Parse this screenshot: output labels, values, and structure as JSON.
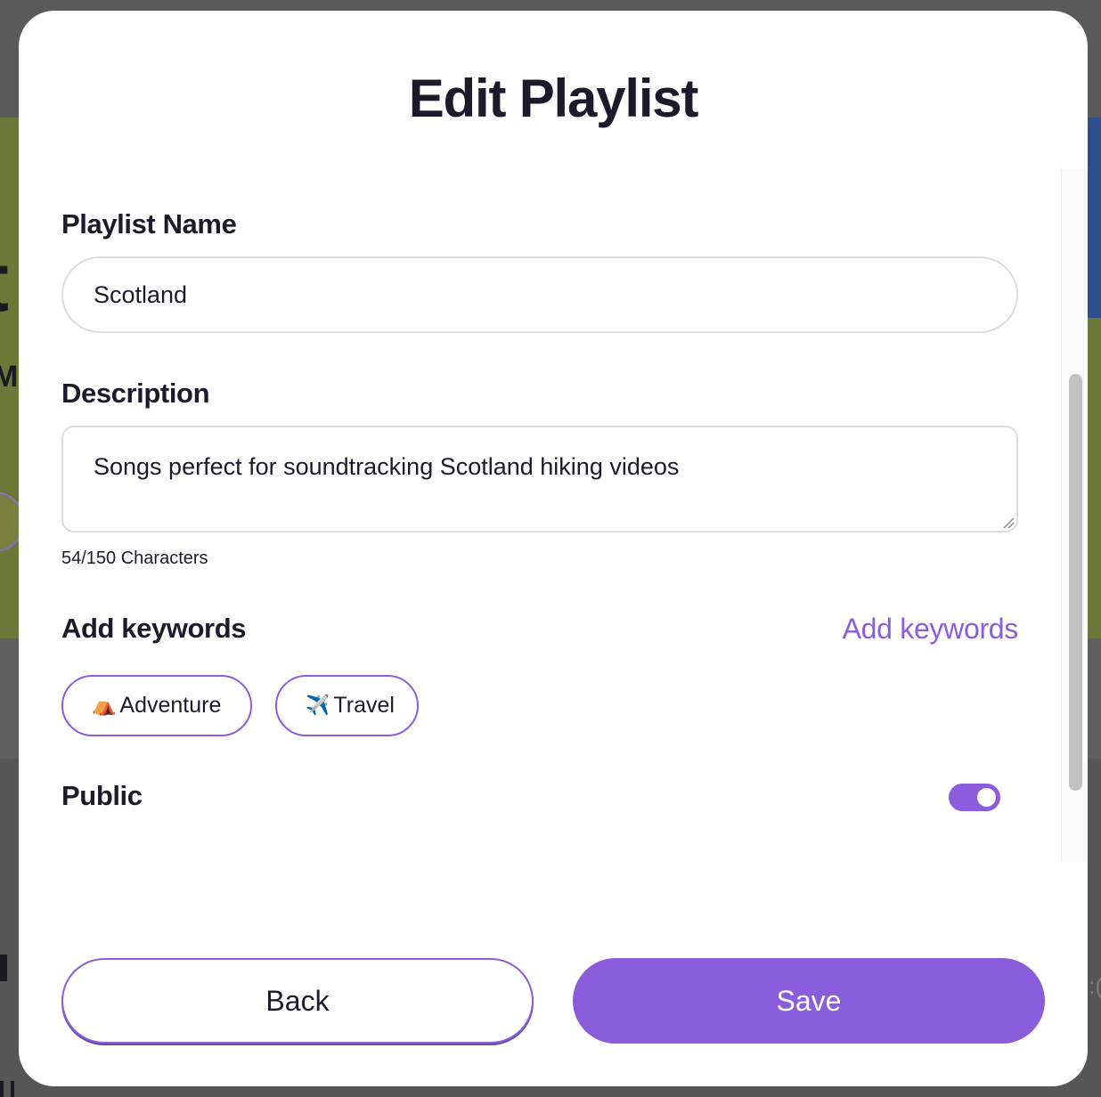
{
  "modal": {
    "title": "Edit Playlist",
    "playlist_name_label": "Playlist Name",
    "playlist_name_value": "Scotland",
    "description_label": "Description",
    "description_value": "Songs perfect for soundtracking Scotland hiking videos",
    "char_count": "54/150 Characters",
    "keywords_label": "Add keywords",
    "keywords_link": "Add keywords",
    "keywords": [
      {
        "emoji": "⛺",
        "label": "Adventure"
      },
      {
        "emoji": "✈️",
        "label": "Travel"
      }
    ],
    "public_label": "Public",
    "public_enabled": true,
    "back_label": "Back",
    "save_label": "Save"
  },
  "background": {
    "big_letter": "t",
    "small_letters": "Ma",
    "right_text": ":("
  },
  "colors": {
    "accent": "#8b5cdb",
    "text": "#1c1b2b"
  }
}
